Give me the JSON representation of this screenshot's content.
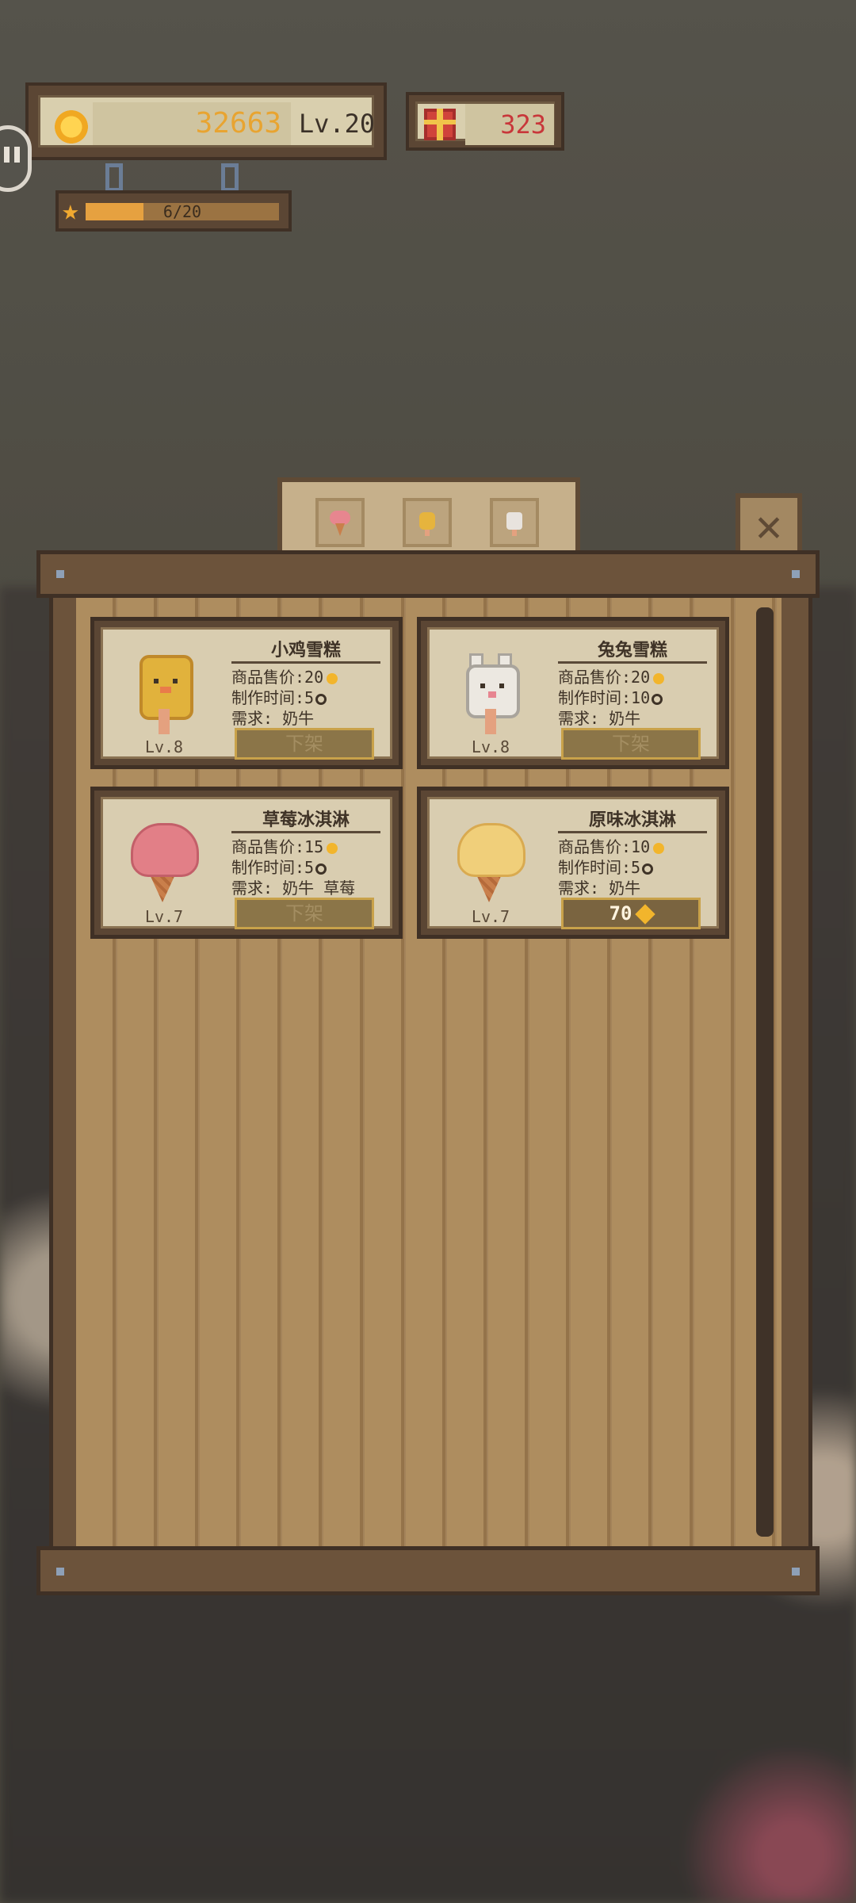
{
  "hud": {
    "gold": "32663",
    "level": "Lv.20",
    "gifts": "323",
    "exp_text": "6/20",
    "exp_progress": 0.3
  },
  "tabs": [
    {
      "name": "strawberry-icecream-tab",
      "color": "#e7868f"
    },
    {
      "name": "chick-popsicle-tab",
      "color": "#e6b43d"
    },
    {
      "name": "bunny-popsicle-tab",
      "color": "#e8e3de"
    }
  ],
  "items": [
    {
      "title": "小鸡雪糕",
      "price_label": "商品售价:",
      "price": "20",
      "time_label": "制作时间:",
      "time": "5",
      "need_label": "需求:",
      "need": "奶牛",
      "level": "Lv.8",
      "button": "下架",
      "button_type": "remove",
      "art": "chick-popsicle",
      "color": "#e1b23c"
    },
    {
      "title": "兔兔雪糕",
      "price_label": "商品售价:",
      "price": "20",
      "time_label": "制作时间:",
      "time": "10",
      "need_label": "需求:",
      "need": "奶牛",
      "level": "Lv.8",
      "button": "下架",
      "button_type": "remove",
      "art": "bunny-popsicle",
      "color": "#ece8e1"
    },
    {
      "title": "草莓冰淇淋",
      "price_label": "商品售价:",
      "price": "15",
      "time_label": "制作时间:",
      "time": "5",
      "need_label": "需求:",
      "need": "奶牛 草莓",
      "level": "Lv.7",
      "button": "下架",
      "button_type": "remove",
      "art": "strawberry-cone",
      "color": "#e27f87"
    },
    {
      "title": "原味冰淇淋",
      "price_label": "商品售价:",
      "price": "10",
      "time_label": "制作时间:",
      "time": "5",
      "need_label": "需求:",
      "need": "奶牛",
      "level": "Lv.7",
      "button": "70",
      "button_type": "price",
      "art": "vanilla-cone",
      "color": "#f0cf7a"
    }
  ],
  "colors": {
    "board": "#6c533b",
    "plank": "#ae8d5f",
    "gold_text": "#e8a431",
    "gift_text": "#c8373a"
  }
}
